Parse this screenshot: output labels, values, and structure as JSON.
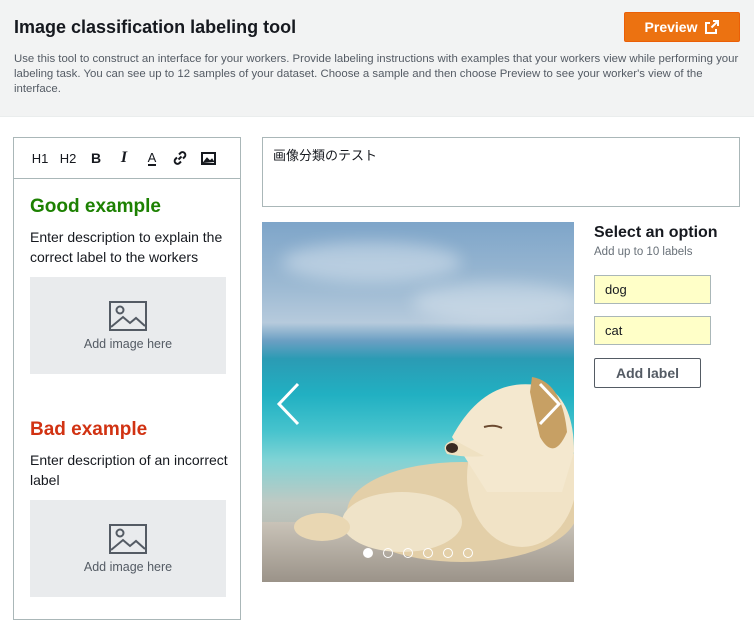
{
  "header": {
    "title": "Image classification labeling tool",
    "preview_label": "Preview",
    "description": "Use this tool to construct an interface for your workers. Provide labeling instructions with examples that your workers view while performing your labeling task. You can see up to 12 samples of your dataset. Choose a sample and then choose Preview to see your worker's view of the interface."
  },
  "editor": {
    "toolbar": [
      "H1",
      "H2",
      "B",
      "I",
      "A",
      "link-icon",
      "image-icon"
    ],
    "good": {
      "heading": "Good example",
      "description": "Enter description to explain the correct label to the workers",
      "image_placeholder": "Add image here"
    },
    "bad": {
      "heading": "Bad example",
      "description": "Enter description of an incorrect label",
      "image_placeholder": "Add image here"
    }
  },
  "question": {
    "text": "画像分類のテスト"
  },
  "carousel": {
    "total": 6,
    "active_index": 0
  },
  "options": {
    "title": "Select an option",
    "subtitle": "Add up to 10 labels",
    "labels": [
      "dog",
      "cat"
    ],
    "add_label": "Add label"
  },
  "colors": {
    "accent": "#ec7211",
    "good": "#1d8102",
    "bad": "#d13212",
    "label_bg": "#ffffc8"
  }
}
